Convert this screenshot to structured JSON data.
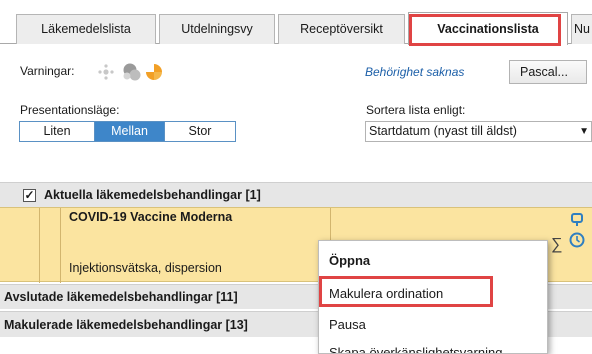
{
  "tabs": [
    {
      "label": "Läkemedelslista"
    },
    {
      "label": "Utdelningsvy"
    },
    {
      "label": "Receptöversikt"
    },
    {
      "label": "Vaccinationslista",
      "active": true
    },
    {
      "label": "Nu"
    }
  ],
  "warnings": {
    "label": "Varningar:",
    "icons": [
      "sparkle-icon",
      "pill-group-icon",
      "pie-warning-icon"
    ]
  },
  "permission_link": "Behörighet saknas",
  "user_button": "Pascal...",
  "presentation": {
    "label": "Presentationsläge:",
    "options": [
      "Liten",
      "Mellan",
      "Stor"
    ],
    "selected": "Mellan"
  },
  "sort": {
    "label": "Sortera lista enligt:",
    "value": "Startdatum (nyast till äldst)"
  },
  "sections": {
    "current": "Aktuella läkemedelsbehandlingar [1]",
    "finished": "Avslutade läkemedelsbehandlingar [11]",
    "cancelled": "Makulerade läkemedelsbehandlingar [13]"
  },
  "row": {
    "name": "COVID-19 Vaccine Moderna",
    "form": "Injektionsvätska, dispersion",
    "sum_symbol": "∑"
  },
  "context_menu": {
    "items": [
      "Öppna",
      "Makulera ordination",
      "Pausa",
      "Skapa överkänslighetsvarning"
    ]
  },
  "colors": {
    "highlight": "#e04444",
    "row_yellow": "#fbe4a0",
    "selected_segment": "#3e86c9",
    "link": "#1c5fa8",
    "icon_orange": "#f2a026",
    "icon_blue": "#2f7fc1"
  }
}
